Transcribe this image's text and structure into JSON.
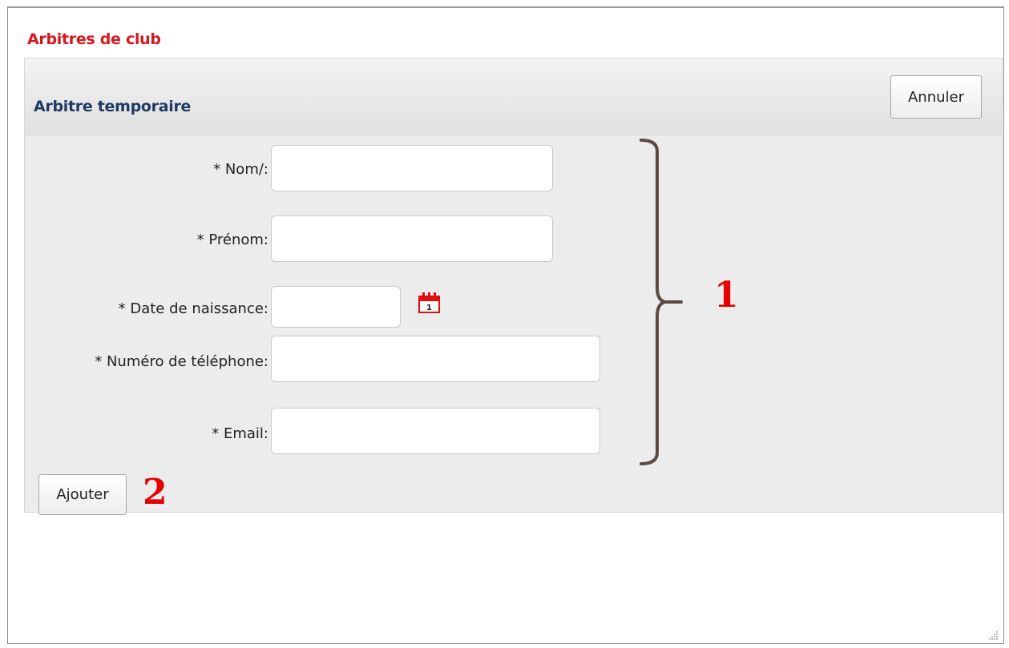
{
  "section": {
    "title": "Arbitres de club"
  },
  "panel": {
    "title": "Arbitre temporaire",
    "cancel_label": "Annuler",
    "add_label": "Ajouter"
  },
  "form": {
    "fields": [
      {
        "label": "* Nom/:",
        "value": "",
        "placeholder": ""
      },
      {
        "label": "* Prénom:",
        "value": "",
        "placeholder": ""
      },
      {
        "label": "* Date de naissance:",
        "value": "",
        "placeholder": ""
      },
      {
        "label": "* Numéro de téléphone:",
        "value": "",
        "placeholder": ""
      },
      {
        "label": "* Email:",
        "value": "",
        "placeholder": ""
      }
    ]
  },
  "annotations": {
    "marker_1": "1",
    "marker_2": "2"
  },
  "calendar": {
    "day": "1"
  },
  "colors": {
    "section_title": "#d8171d",
    "panel_title": "#1f3a63",
    "annotation": "#e60000",
    "bracket": "#5a4a44",
    "calendar_icon": "#e01010"
  },
  "icons": {
    "calendar": "calendar-icon",
    "resize": "resize-grip-icon"
  }
}
